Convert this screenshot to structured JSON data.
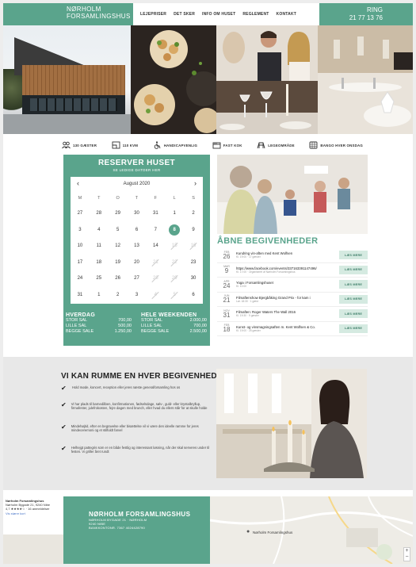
{
  "header": {
    "logo_line1": "NØRHOLM",
    "logo_line2": "FORSAMLINGSHUS",
    "nav": [
      "LEJEPRISER",
      "DET SKER",
      "INFO OM HUSET",
      "REGLEMENT",
      "KONTAKT"
    ],
    "phone_label": "RING",
    "phone_number": "21 77 13 76"
  },
  "amenities": [
    {
      "icon": "people-icon",
      "label": "130 GÆSTER"
    },
    {
      "icon": "parking-icon",
      "label": "110 KVM"
    },
    {
      "icon": "wheelchair-icon",
      "label": "HANDICAPVENLIG"
    },
    {
      "icon": "kitchen-icon",
      "label": "FAST KOK"
    },
    {
      "icon": "playground-icon",
      "label": "LEGEOMRÅDE"
    },
    {
      "icon": "bingo-icon",
      "label": "BANGO HVER ONSDAG"
    }
  ],
  "booking": {
    "title": "RESERVER HUSET",
    "subtitle": "SE LEDIGE DATOER HER",
    "month": "August 2020",
    "dow": [
      "M",
      "T",
      "O",
      "T",
      "F",
      "L",
      "S"
    ],
    "weeks": [
      [
        {
          "t": "27"
        },
        {
          "t": "28"
        },
        {
          "t": "29"
        },
        {
          "t": "30"
        },
        {
          "t": "31"
        },
        {
          "t": "1"
        },
        {
          "t": "2"
        }
      ],
      [
        {
          "t": "3"
        },
        {
          "t": "4"
        },
        {
          "t": "5"
        },
        {
          "t": "6"
        },
        {
          "t": "7"
        },
        {
          "t": "8",
          "s": "sel"
        },
        {
          "t": "9"
        }
      ],
      [
        {
          "t": "10"
        },
        {
          "t": "11"
        },
        {
          "t": "12"
        },
        {
          "t": "13"
        },
        {
          "t": "14"
        },
        {
          "t": "15",
          "s": "dis"
        },
        {
          "t": "16",
          "s": "dis"
        }
      ],
      [
        {
          "t": "17"
        },
        {
          "t": "18"
        },
        {
          "t": "19"
        },
        {
          "t": "20"
        },
        {
          "t": "21",
          "s": "dis"
        },
        {
          "t": "22",
          "s": "dis"
        },
        {
          "t": "23"
        }
      ],
      [
        {
          "t": "24"
        },
        {
          "t": "25"
        },
        {
          "t": "26"
        },
        {
          "t": "27"
        },
        {
          "t": "28",
          "s": "dis"
        },
        {
          "t": "29",
          "s": "dis"
        },
        {
          "t": "30"
        }
      ],
      [
        {
          "t": "31"
        },
        {
          "t": "1"
        },
        {
          "t": "2"
        },
        {
          "t": "3"
        },
        {
          "t": "4",
          "s": "dis"
        },
        {
          "t": "5",
          "s": "dis"
        },
        {
          "t": "6"
        }
      ]
    ],
    "weekday_title": "HVERDAG",
    "weekday_rows": [
      [
        "STOR SAL",
        "700,00"
      ],
      [
        "LILLE SAL",
        "500,00"
      ],
      [
        "BEGGE SALE",
        "1.250,00"
      ]
    ],
    "weekend_title": "HELE WEEKENDEN",
    "weekend_rows": [
      [
        "STOR SAL",
        "2.000,00"
      ],
      [
        "LILLE SAL",
        "700,00"
      ],
      [
        "BEGGE SALE",
        "2.500,00"
      ]
    ]
  },
  "events": {
    "title": "ÅBNE BEGIVENHEDER",
    "button_label": "LÆS MERE",
    "items": [
      {
        "mon": "FEB",
        "day": "26",
        "name": "Kundring vin-aften med Kent Wolfsen",
        "meta": "Kl. 19:00 · 17 gæster"
      },
      {
        "mon": "MAR",
        "day": "9",
        "name": "https://www.facebook.com/events/337163391147496/",
        "meta": "Kl. 17:00 · Organiseret af Nørholm Forsamlingshus"
      },
      {
        "mon": "APR",
        "day": "24",
        "name": "Yoga i Forsamlingshuset",
        "meta": "Kl. 10:00"
      },
      {
        "mon": "JUN",
        "day": "21",
        "name": "Filmaftenshow Bjergbåking Grand Prix - for kam i",
        "meta": "Lør. 18:30 · 1 gæst"
      },
      {
        "mon": "NOV",
        "day": "31",
        "name": "Filmaften: Roger Waters The Wall 2016",
        "meta": "Kl. 19:30 · 9 gæster"
      },
      {
        "mon": "FEB",
        "day": "18",
        "name": "Kunst- og vinsmagningsaften m. Kent Wolfsen & Co.",
        "meta": "Kl. 19:00 · 25 gæster"
      }
    ]
  },
  "section2": {
    "title": "VI KAN RUMME EN HVER BEGIVENHED",
    "features": [
      "Hold møde, koncert, reception eller jeres næste generalforsamling hos os",
      "Vi har plads til barnedåben, konfirmationen, fødselsdage, sølv-, guld- eller krystalbryllup, firmafester, julefrokosten, fejre dagen med brunch, eller hvad du ellers står for at skulle holde",
      "Mindehøjtid, efter en begravelse eller bisættelse vil vi være den ideelle ramme for jeres mindeceremoni og et stilfuldt farvel",
      "Helhejgt pattegris som er en både festlig og interessant løsning, når der skal serveres under til festen. Vi griller året rundt"
    ]
  },
  "footer": {
    "card_name": "Nørholm Forsamlingshus",
    "card_address": "Nørholm Bygade 21, 9240 Nibe",
    "card_rating": "4,7 ★★★★☆ · 16 anmeldelser",
    "card_link": "Vis større kort",
    "name": "NØRHOLM FORSAMLINGSHUS",
    "address": "NØRHOLM BYGADE 21 · NØRHOLM",
    "city": "9240 NIBE",
    "contact": "BANKKONTONR. 7367 4024428790",
    "map_pin_label": "Nørholm Forsamlingshus",
    "zoom_in": "+",
    "zoom_out": "−"
  },
  "colors": {
    "brand": "#5aa48c",
    "button_bg": "#d5eae1"
  }
}
